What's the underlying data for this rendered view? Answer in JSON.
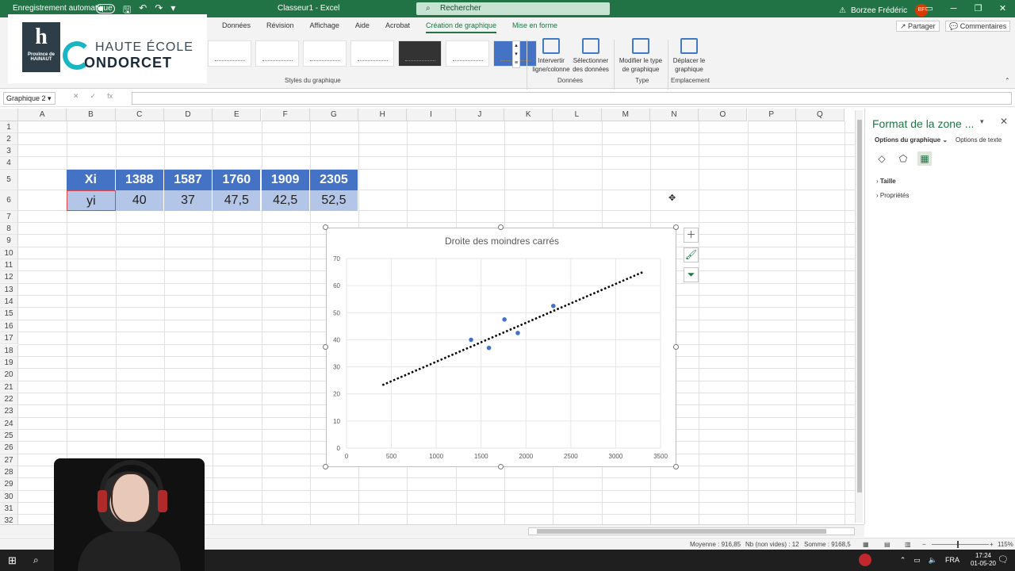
{
  "titlebar": {
    "autosave_label": "Enregistrement automatique",
    "doc_title": "Classeur1 - Excel",
    "search_placeholder": "Rechercher",
    "user_name": "Borzee Frédéric",
    "user_initials": "BF"
  },
  "ribbon": {
    "tabs": [
      "Données",
      "Révision",
      "Affichage",
      "Aide",
      "Acrobat",
      "Création de graphique",
      "Mise en forme"
    ],
    "share_label": "Partager",
    "comments_label": "Commentaires",
    "group_styles": "Styles du graphique",
    "group_donnees": "Données",
    "group_type": "Type",
    "group_emplacement": "Emplacement",
    "btn_intervertir": "Intervertir ligne/colonne",
    "btn_selectionner": "Sélectionner des données",
    "btn_modifier_type": "Modifier le type de graphique",
    "btn_deplacer": "Déplacer le graphique"
  },
  "logo": {
    "crest_text": "Province de HAINAUT",
    "line1": "HAUTE ÉCOLE",
    "line2": "ONDORCET"
  },
  "formula_bar": {
    "name_box": "Graphique 2",
    "fx": "fx",
    "value": ""
  },
  "sheet": {
    "columns": [
      "A",
      "B",
      "C",
      "D",
      "E",
      "F",
      "G",
      "H",
      "I",
      "J",
      "K",
      "L",
      "M",
      "N",
      "O",
      "P",
      "Q"
    ],
    "rows": [
      "1",
      "2",
      "3",
      "4",
      "5",
      "6",
      "7",
      "8",
      "9",
      "10",
      "11",
      "12",
      "13",
      "14",
      "15",
      "16",
      "17",
      "18",
      "19",
      "20",
      "21",
      "22",
      "23",
      "24",
      "25",
      "26",
      "27",
      "28",
      "29",
      "30",
      "31",
      "32"
    ],
    "table": {
      "header_label": "Xi",
      "row_label": "yi",
      "xi": [
        "1388",
        "1587",
        "1760",
        "1909",
        "2305"
      ],
      "yi": [
        "40",
        "37",
        "47,5",
        "42,5",
        "52,5"
      ]
    }
  },
  "chart_data": {
    "type": "scatter",
    "title": "Droite des moindres carrés",
    "x": [
      1388,
      1587,
      1760,
      1909,
      2305
    ],
    "y": [
      40,
      37,
      47.5,
      42.5,
      52.5
    ],
    "xlim": [
      0,
      3500
    ],
    "ylim": [
      0,
      70
    ],
    "x_ticks": [
      0,
      500,
      1000,
      1500,
      2000,
      2500,
      3000,
      3500
    ],
    "y_ticks": [
      0,
      10,
      20,
      30,
      40,
      50,
      60,
      70
    ],
    "trendline": {
      "type": "linear",
      "x_start": 400,
      "x_end": 3300,
      "slope": 0.01438,
      "intercept": 17.5,
      "style": "dotted",
      "color": "#000000"
    },
    "marker_color": "#4472c4",
    "grid": true
  },
  "pane": {
    "title": "Format de la zone ...",
    "tab_graph": "Options du graphique",
    "tab_text": "Options de texte",
    "section_taille": "Taille",
    "section_proprietes": "Propriétés"
  },
  "status": {
    "moyenne": "Moyenne : 916,85",
    "nb": "Nb (non vides) : 12",
    "somme": "Somme : 9168,5",
    "zoom": "115%"
  },
  "taskbar": {
    "lang": "FRA",
    "time": "17:24",
    "date": "01-05-20"
  },
  "colors": {
    "excel_green": "#217346",
    "table_header": "#4472c4",
    "table_values": "#b4c6e7"
  }
}
